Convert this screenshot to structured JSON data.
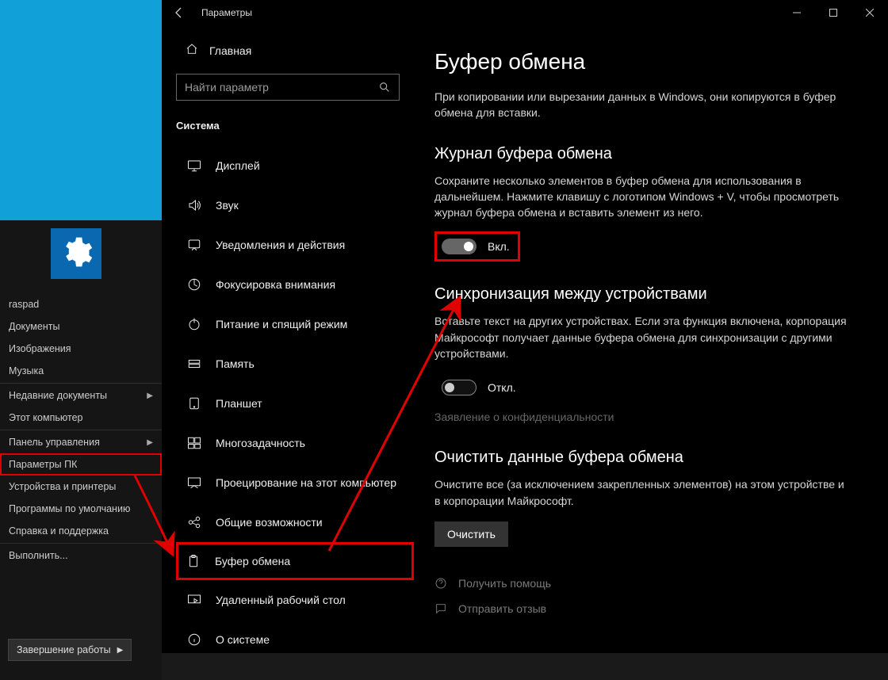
{
  "start": {
    "username": "raspad",
    "items": [
      {
        "label": "Документы",
        "sub": false
      },
      {
        "label": "Изображения",
        "sub": false
      },
      {
        "label": "Музыка",
        "sub": false
      }
    ],
    "items2": [
      {
        "label": "Недавние документы",
        "sub": true
      },
      {
        "label": "Этот компьютер",
        "sub": false
      }
    ],
    "items3": [
      {
        "label": "Панель управления",
        "sub": true
      },
      {
        "label": "Параметры ПК",
        "sub": false,
        "highlight": true
      },
      {
        "label": "Устройства и принтеры",
        "sub": false
      },
      {
        "label": "Программы по умолчанию",
        "sub": false
      },
      {
        "label": "Справка и поддержка",
        "sub": false
      }
    ],
    "items4": [
      {
        "label": "Выполнить...",
        "sub": false
      }
    ],
    "shutdown": "Завершение работы"
  },
  "titlebar": {
    "title": "Параметры"
  },
  "nav": {
    "home": "Главная",
    "search_placeholder": "Найти параметр",
    "category": "Система",
    "items": [
      {
        "key": "display",
        "label": "Дисплей"
      },
      {
        "key": "sound",
        "label": "Звук"
      },
      {
        "key": "notifications",
        "label": "Уведомления и действия"
      },
      {
        "key": "focus",
        "label": "Фокусировка внимания"
      },
      {
        "key": "power",
        "label": "Питание и спящий режим"
      },
      {
        "key": "storage",
        "label": "Память"
      },
      {
        "key": "tablet",
        "label": "Планшет"
      },
      {
        "key": "multitask",
        "label": "Многозадачность"
      },
      {
        "key": "projecting",
        "label": "Проецирование на этот компьютер"
      },
      {
        "key": "shared",
        "label": "Общие возможности"
      },
      {
        "key": "clipboard",
        "label": "Буфер обмена",
        "highlight": true
      },
      {
        "key": "remote",
        "label": "Удаленный рабочий стол"
      },
      {
        "key": "about",
        "label": "О системе"
      }
    ]
  },
  "content": {
    "title": "Буфер обмена",
    "intro": "При копировании или вырезании данных в Windows, они копируются в буфер обмена для вставки.",
    "history": {
      "heading": "Журнал буфера обмена",
      "desc": "Сохраните несколько элементов в буфер обмена для использования в дальнейшем. Нажмите клавишу с логотипом Windows + V, чтобы просмотреть журнал буфера обмена и вставить элемент из него.",
      "state_label": "Вкл."
    },
    "sync": {
      "heading": "Синхронизация между устройствами",
      "desc": "Вставьте текст на других устройствах. Если эта функция включена, корпорация Майкрософт получает данные буфера обмена для синхронизации с другими устройствами.",
      "state_label": "Откл.",
      "privacy": "Заявление о конфиденциальности"
    },
    "clear": {
      "heading": "Очистить данные буфера обмена",
      "desc": "Очистите все (за исключением закрепленных элементов) на этом устройстве и в корпорации Майкрософт.",
      "button": "Очистить"
    },
    "help_link": "Получить помощь",
    "feedback_link": "Отправить отзыв"
  }
}
